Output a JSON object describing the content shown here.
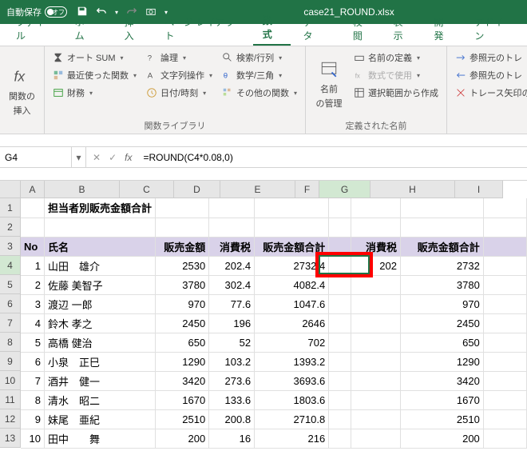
{
  "title_bar": {
    "autosave_label": "自動保存",
    "autosave_state": "オフ",
    "filename": "case21_ROUND.xlsx"
  },
  "tabs": [
    "ファイル",
    "ホーム",
    "挿入",
    "ページ レイアウト",
    "数式",
    "データ",
    "校閲",
    "表示",
    "開発",
    "アドイン"
  ],
  "active_tab": 4,
  "ribbon": {
    "insert_fn": {
      "label1": "関数の",
      "label2": "挿入"
    },
    "library": {
      "autosum": "オート SUM",
      "recent": "最近使った関数",
      "financial": "財務",
      "logical": "論理",
      "text": "文字列操作",
      "datetime": "日付/時刻",
      "lookup": "検索/行列",
      "math": "数学/三角",
      "more": "その他の関数",
      "group_label": "関数ライブラリ"
    },
    "names": {
      "manager1": "名前",
      "manager2": "の管理",
      "define": "名前の定義",
      "use": "数式で使用",
      "create": "選択範囲から作成",
      "group_label": "定義された名前"
    },
    "audit": {
      "precedents": "参照元のトレ",
      "dependents": "参照先のトレ",
      "remove": "トレース矢印の"
    }
  },
  "formula_bar": {
    "name_box": "G4",
    "formula": "=ROUND(C4*0.08,0)"
  },
  "columns": [
    "A",
    "B",
    "C",
    "D",
    "E",
    "F",
    "G",
    "H",
    "I"
  ],
  "active_col": "G",
  "active_row": 4,
  "sheet": {
    "title": "担当者別販売金額合計",
    "headers": {
      "no": "No",
      "name": "氏名",
      "sales": "販売金額",
      "tax": "消費税",
      "total": "販売金額合計",
      "tax2": "消費税",
      "total2": "販売金額合計"
    },
    "rows": [
      {
        "no": 1,
        "name": "山田　雄介",
        "sales": 2530,
        "tax": "202.4",
        "total": "2732.4",
        "tax2": 202,
        "total2": 2732
      },
      {
        "no": 2,
        "name": "佐藤 美智子",
        "sales": 3780,
        "tax": "302.4",
        "total": "4082.4",
        "tax2": "",
        "total2": 3780
      },
      {
        "no": 3,
        "name": "渡辺 一郎",
        "sales": 970,
        "tax": "77.6",
        "total": "1047.6",
        "tax2": "",
        "total2": 970
      },
      {
        "no": 4,
        "name": "鈴木 孝之",
        "sales": 2450,
        "tax": "196",
        "total": "2646",
        "tax2": "",
        "total2": 2450
      },
      {
        "no": 5,
        "name": "高橋 健治",
        "sales": 650,
        "tax": "52",
        "total": "702",
        "tax2": "",
        "total2": 650
      },
      {
        "no": 6,
        "name": "小泉　正巳",
        "sales": 1290,
        "tax": "103.2",
        "total": "1393.2",
        "tax2": "",
        "total2": 1290
      },
      {
        "no": 7,
        "name": "酒井　健一",
        "sales": 3420,
        "tax": "273.6",
        "total": "3693.6",
        "tax2": "",
        "total2": 3420
      },
      {
        "no": 8,
        "name": "清水　昭二",
        "sales": 1670,
        "tax": "133.6",
        "total": "1803.6",
        "tax2": "",
        "total2": 1670
      },
      {
        "no": 9,
        "name": "妹尾　亜紀",
        "sales": 2510,
        "tax": "200.8",
        "total": "2710.8",
        "tax2": "",
        "total2": 2510
      },
      {
        "no": 10,
        "name": "田中　　舞",
        "sales": 200,
        "tax": "16",
        "total": "216",
        "tax2": "",
        "total2": 200
      }
    ]
  }
}
